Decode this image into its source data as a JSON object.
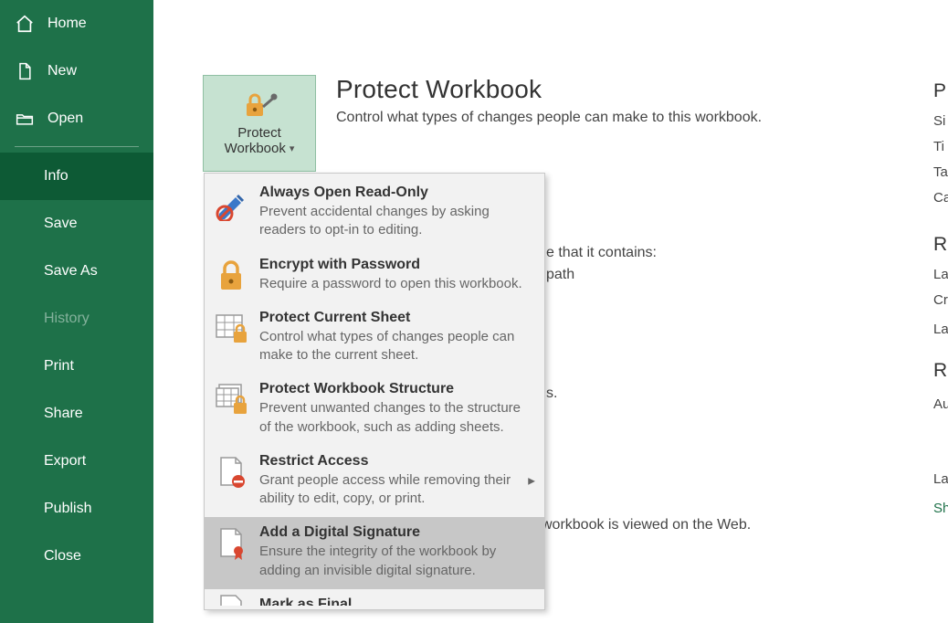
{
  "sidebar": {
    "items": [
      {
        "label": "Home"
      },
      {
        "label": "New"
      },
      {
        "label": "Open"
      },
      {
        "label": "Info"
      },
      {
        "label": "Save"
      },
      {
        "label": "Save As"
      },
      {
        "label": "History"
      },
      {
        "label": "Print"
      },
      {
        "label": "Share"
      },
      {
        "label": "Export"
      },
      {
        "label": "Publish"
      },
      {
        "label": "Close"
      }
    ]
  },
  "protect": {
    "tile_line1": "Protect",
    "tile_line2": "Workbook",
    "title": "Protect Workbook",
    "sub": "Control what types of changes people can make to this workbook."
  },
  "bg": {
    "l1": "e that it contains:",
    "l2": "path",
    "l3": "s.",
    "l4": "workbook is viewed on the Web."
  },
  "menu": {
    "items": [
      {
        "title": "Always Open Read-Only",
        "desc": "Prevent accidental changes by asking readers to opt-in to editing."
      },
      {
        "title": "Encrypt with Password",
        "desc": "Require a password to open this workbook."
      },
      {
        "title": "Protect Current Sheet",
        "desc": "Control what types of changes people can make to the current sheet."
      },
      {
        "title": "Protect Workbook Structure",
        "desc": "Prevent unwanted changes to the structure of the workbook, such as adding sheets."
      },
      {
        "title": "Restrict Access",
        "desc": "Grant people access while removing their ability to edit, copy, or print."
      },
      {
        "title": "Add a Digital Signature",
        "desc": "Ensure the integrity of the workbook by adding an invisible digital signature."
      },
      {
        "title": "Mark as Final",
        "desc": ""
      }
    ]
  },
  "right": {
    "h1": "P",
    "l_size": "Si",
    "l_title": "Ti",
    "l_tags": "Ta",
    "l_cat": "Ca",
    "h2": "R",
    "l_lastmod": "La",
    "l_created": "Cr",
    "l_lastprint": "La",
    "h3": "R",
    "l_author": "Au",
    "l_lastmodby": "La",
    "l_show": "Sh"
  }
}
